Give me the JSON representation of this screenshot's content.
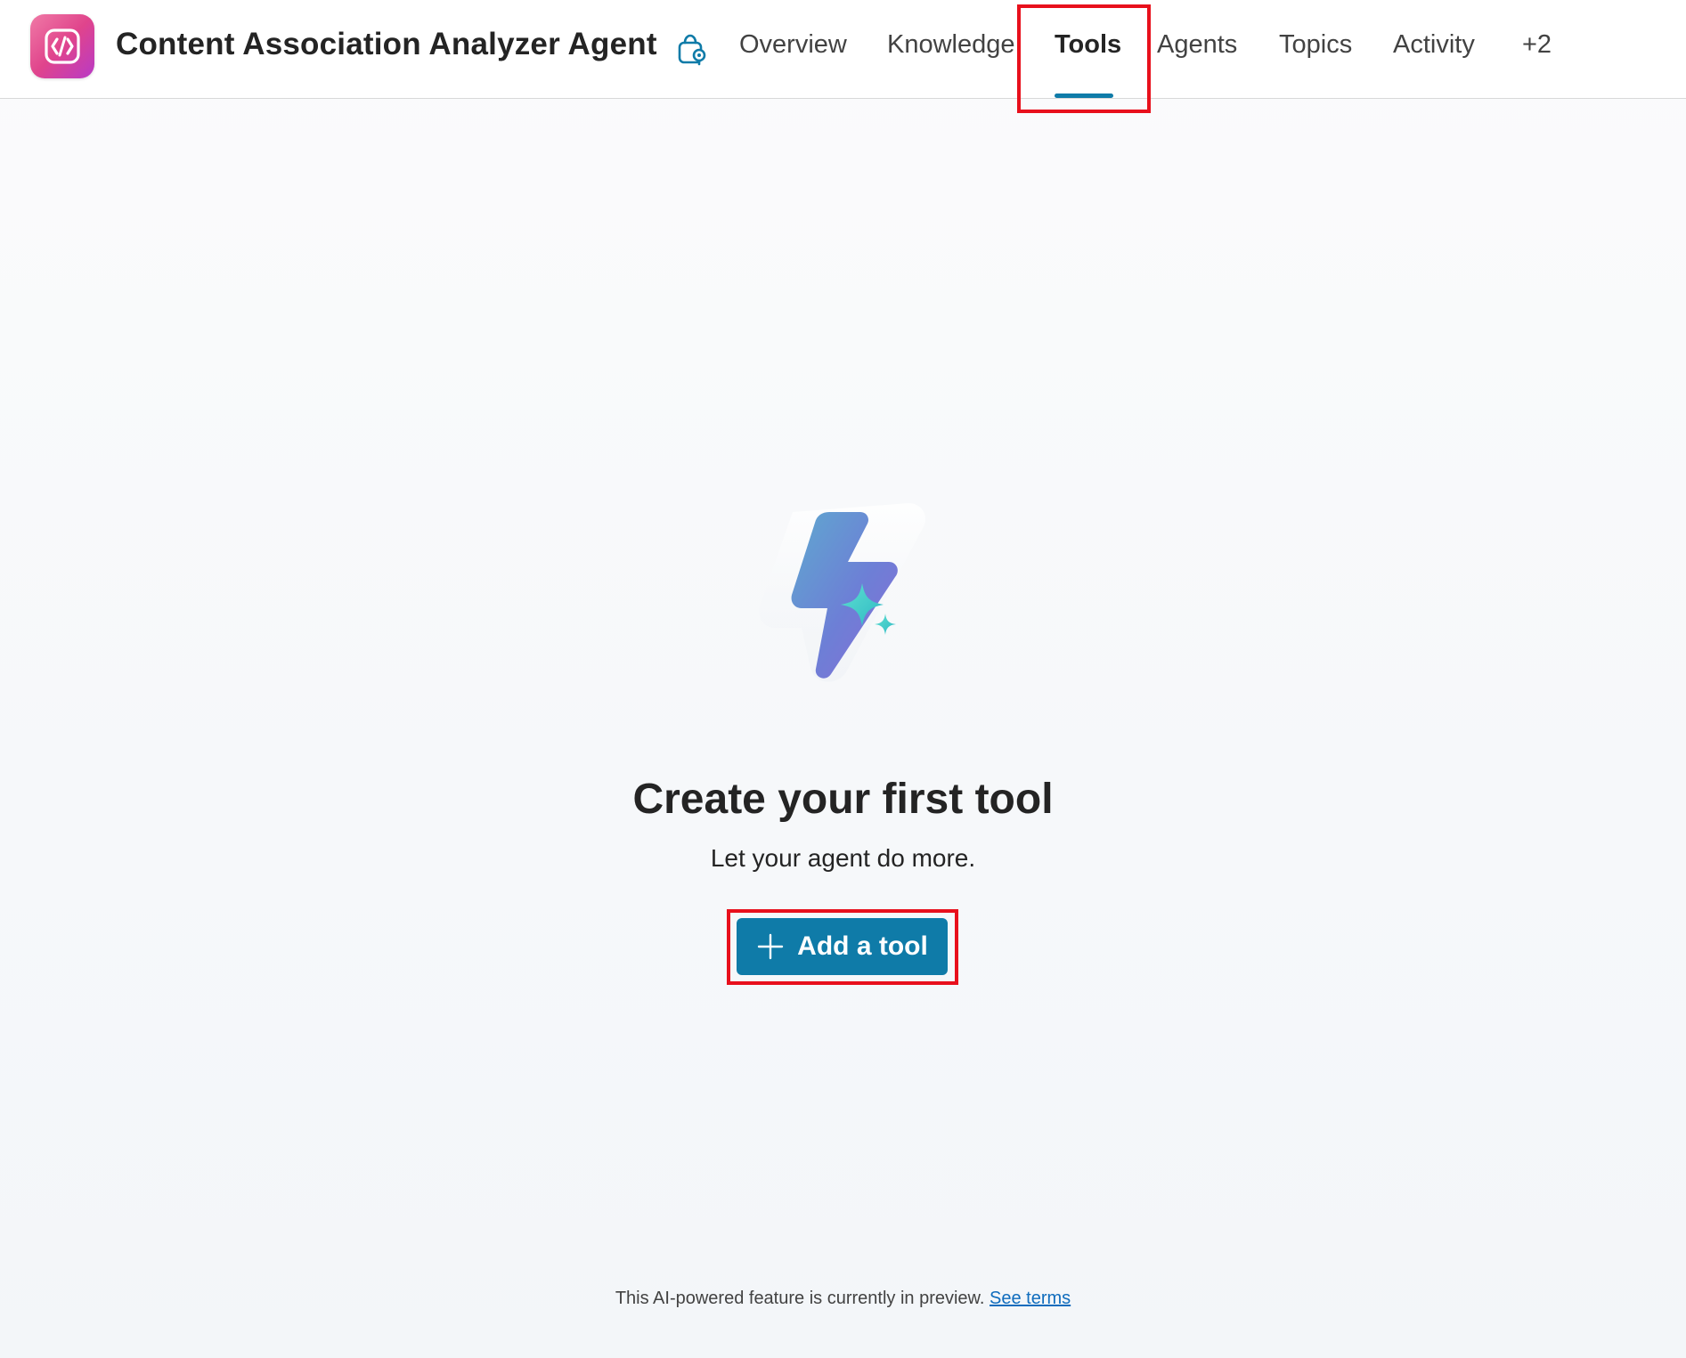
{
  "header": {
    "agent_title": "Content Association Analyzer Agent",
    "app_icon": "code-brackets-icon",
    "settings_icon": "bag-settings-icon",
    "tabs": [
      {
        "label": "Overview",
        "active": false
      },
      {
        "label": "Knowledge",
        "active": false
      },
      {
        "label": "Tools",
        "active": true
      },
      {
        "label": "Agents",
        "active": false
      },
      {
        "label": "Topics",
        "active": false
      },
      {
        "label": "Activity",
        "active": false
      },
      {
        "label": "+2",
        "active": false
      }
    ]
  },
  "empty_state": {
    "illustration": "lightning-sparkle-icon",
    "title": "Create your first tool",
    "subtitle": "Let your agent do more.",
    "button_label": "Add a tool",
    "button_icon": "plus-icon"
  },
  "footer": {
    "text": "This AI-powered feature is currently in preview.",
    "link_label": "See terms"
  },
  "colors": {
    "accent": "#0f7ba8",
    "highlight": "#e8101c",
    "link": "#0f6cbd"
  }
}
